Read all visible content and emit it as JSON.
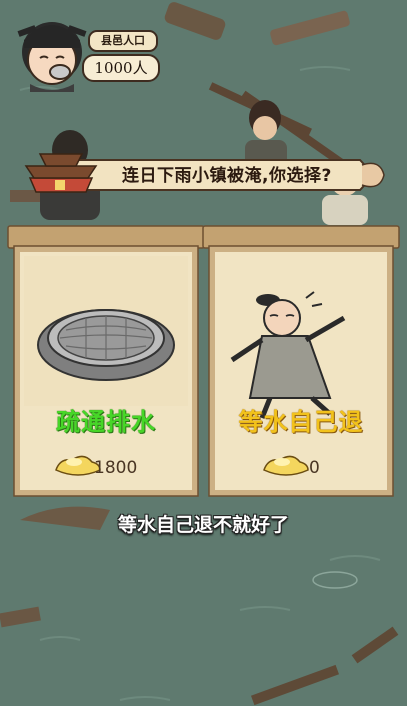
{
  "population": {
    "label": "县邑人口",
    "value": "1000人"
  },
  "question": {
    "text": "连日下雨小镇被淹,你选择?"
  },
  "options": [
    {
      "title": "疏通排水",
      "cost": "1800",
      "icon": "drain-cover-icon"
    },
    {
      "title": "等水自己退",
      "cost": "0",
      "icon": "relaxed-villager-icon"
    }
  ],
  "subtitle": {
    "text": "等水自己退不就好了"
  },
  "colors": {
    "background": "#5f7a6f",
    "card_paper": "#f1e4c3",
    "card_frame": "#c8a97a",
    "green_title": "#47d628",
    "yellow_title": "#f2c21b"
  }
}
